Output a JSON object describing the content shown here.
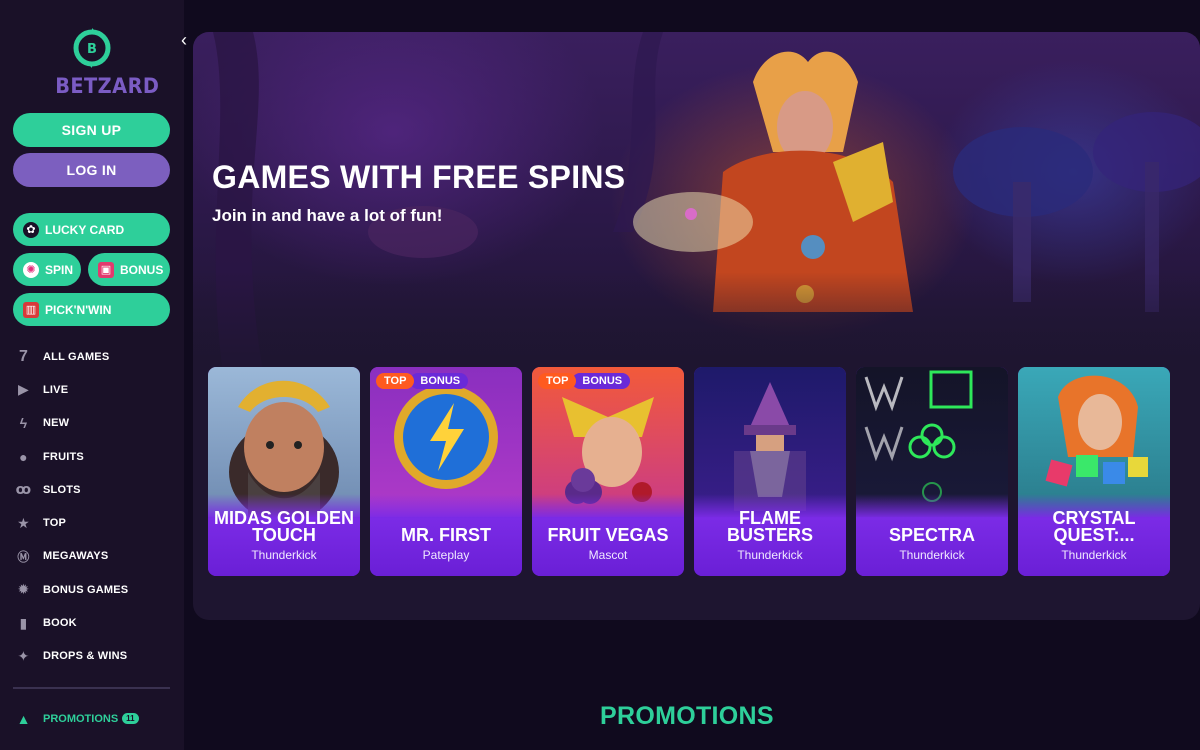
{
  "brand": {
    "name": "BETZARD"
  },
  "auth": {
    "signup": "SIGN UP",
    "login": "LOG IN"
  },
  "quick": {
    "lucky_card": "LUCKY CARD",
    "spin": "SPIN",
    "bonus": "BONUS",
    "pick_n_win": "PICK'N'WIN"
  },
  "nav": [
    {
      "label": "ALL GAMES",
      "icon": "seven-icon"
    },
    {
      "label": "LIVE",
      "icon": "play-icon"
    },
    {
      "label": "NEW",
      "icon": "lightning-icon"
    },
    {
      "label": "FRUITS",
      "icon": "fruit-icon"
    },
    {
      "label": "SLOTS",
      "icon": "cherries-icon"
    },
    {
      "label": "TOP",
      "icon": "star-icon"
    },
    {
      "label": "MEGAWAYS",
      "icon": "megaways-icon"
    },
    {
      "label": "BONUS GAMES",
      "icon": "bonus-gear-icon"
    },
    {
      "label": "BOOK",
      "icon": "book-icon"
    },
    {
      "label": "DROPS & WINS",
      "icon": "drops-icon"
    }
  ],
  "promotions_nav": {
    "label": "PROMOTIONS",
    "count": "11"
  },
  "hero": {
    "title": "GAMES WITH FREE SPINS",
    "subtitle": "Join in and have a lot of fun!"
  },
  "games": [
    {
      "title": "MIDAS GOLDEN TOUCH",
      "provider": "Thunderkick",
      "badges": []
    },
    {
      "title": "MR. FIRST",
      "provider": "Pateplay",
      "badges": [
        "TOP",
        "BONUS"
      ]
    },
    {
      "title": "FRUIT VEGAS",
      "provider": "Mascot",
      "badges": [
        "TOP",
        "BONUS"
      ]
    },
    {
      "title": "FLAME BUSTERS",
      "provider": "Thunderkick",
      "badges": []
    },
    {
      "title": "SPECTRA",
      "provider": "Thunderkick",
      "badges": []
    },
    {
      "title": "CRYSTAL QUEST:...",
      "provider": "Thunderkick",
      "badges": []
    }
  ],
  "section": {
    "promotions": "PROMOTIONS"
  },
  "colors": {
    "accent": "#2ecf9a",
    "login": "#7c5fbf",
    "card": "#7b2be6",
    "top_badge": "#ff5a1f",
    "sidebar": "#1a1128"
  }
}
